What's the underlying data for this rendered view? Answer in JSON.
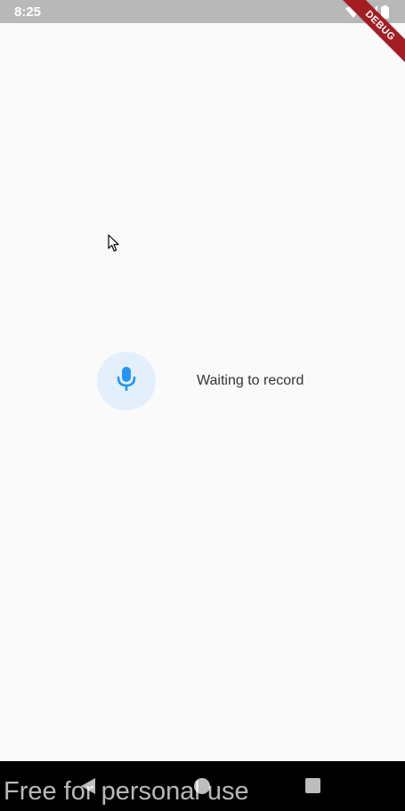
{
  "status_bar": {
    "time": "8:25",
    "icons": [
      "wifi-icon",
      "signal-icon",
      "battery-icon"
    ]
  },
  "debug_banner": {
    "label": "DEBUG",
    "color": "#a31d22"
  },
  "recorder": {
    "icon": "microphone-icon",
    "status_text": "Waiting to record",
    "accent_color": "#2196f3",
    "button_background": "#e3f0fc"
  },
  "nav_bar": {
    "buttons": [
      "back-icon",
      "home-icon",
      "recents-icon"
    ]
  },
  "watermark": {
    "text": "Free for personal use"
  }
}
